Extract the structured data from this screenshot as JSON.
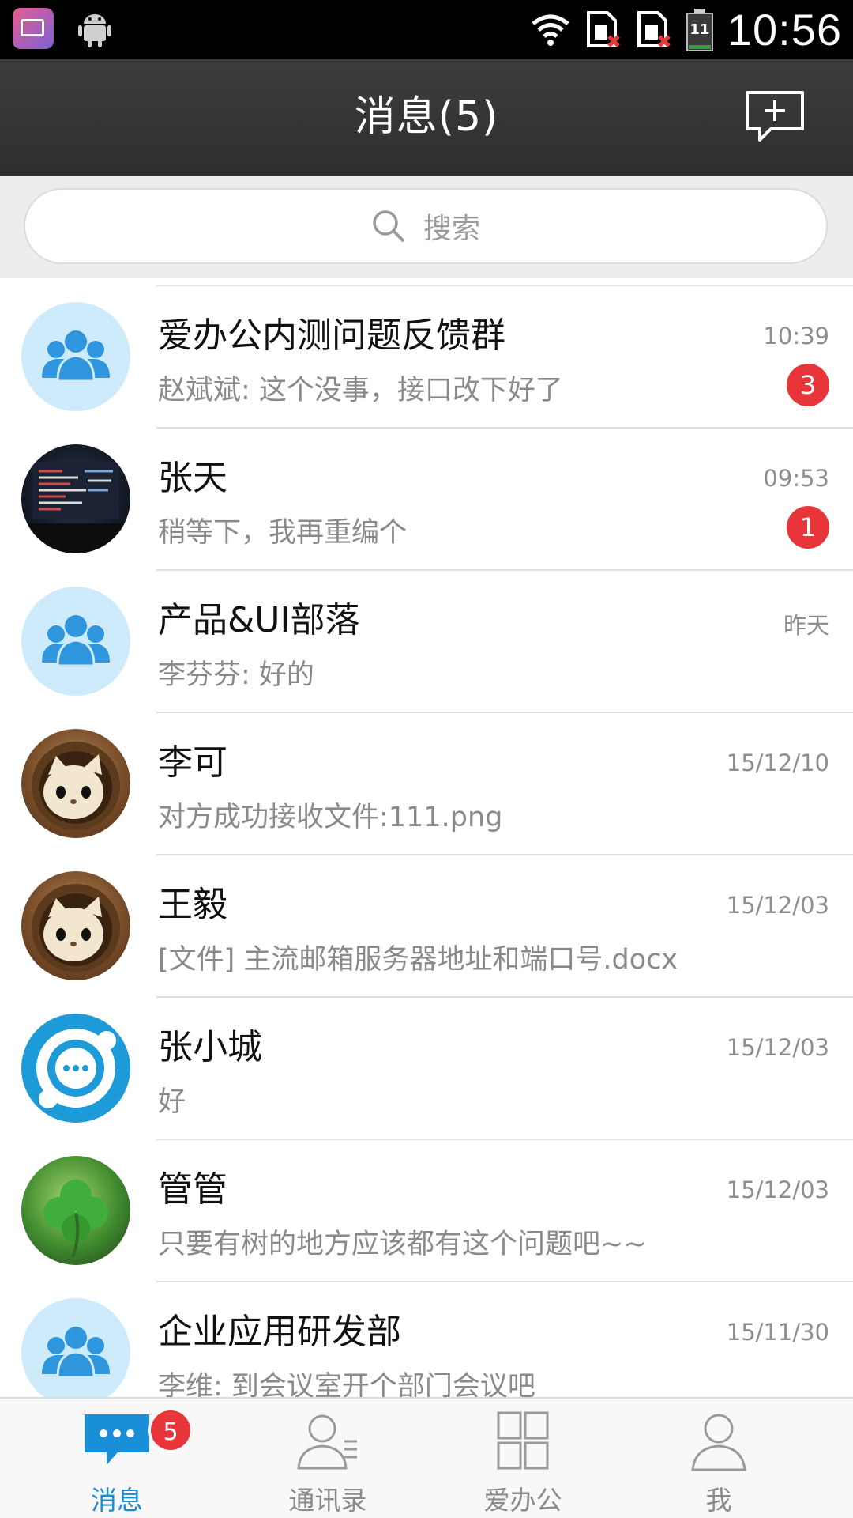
{
  "status_bar": {
    "time": "10:56",
    "battery_level": "11",
    "icons": [
      "mail-app-icon",
      "android-icon",
      "wifi-icon",
      "sim-card-icon",
      "sim-card-icon",
      "battery-icon"
    ]
  },
  "header": {
    "title": "消息(5)",
    "compose_icon": "new-chat-icon"
  },
  "search": {
    "placeholder": "搜索",
    "icon": "search-icon"
  },
  "conversations": [
    {
      "name": "爱办公内测问题反馈群",
      "time": "10:39",
      "preview": "赵斌斌: 这个没事，接口改下好了",
      "unread": "3",
      "avatar": "group-avatar"
    },
    {
      "name": "张天",
      "time": "09:53",
      "preview": "稍等下，我再重编个",
      "unread": "1",
      "avatar": "code-screen-avatar"
    },
    {
      "name": "产品&UI部落",
      "time": "昨天",
      "preview": "李芬芬: 好的",
      "unread": "",
      "avatar": "group-avatar"
    },
    {
      "name": "李可",
      "time": "15/12/10",
      "preview": "对方成功接收文件:111.png",
      "unread": "",
      "avatar": "cat-avatar"
    },
    {
      "name": "王毅",
      "time": "15/12/03",
      "preview": "[文件] 主流邮箱服务器地址和端口号.docx",
      "unread": "",
      "avatar": "cat-avatar"
    },
    {
      "name": "张小城",
      "time": "15/12/03",
      "preview": "好",
      "unread": "",
      "avatar": "chat-logo-avatar"
    },
    {
      "name": "管管",
      "time": "15/12/03",
      "preview": "只要有树的地方应该都有这个问题吧~~",
      "unread": "",
      "avatar": "clover-avatar"
    },
    {
      "name": "企业应用研发部",
      "time": "15/11/30",
      "preview": "李维: 到会议室开个部门会议吧",
      "unread": "",
      "avatar": "group-avatar"
    }
  ],
  "tabs": [
    {
      "label": "消息",
      "icon": "message-bubble-icon",
      "active": true,
      "badge": "5"
    },
    {
      "label": "通讯录",
      "icon": "contacts-icon",
      "active": false,
      "badge": ""
    },
    {
      "label": "爱办公",
      "icon": "apps-grid-icon",
      "active": false,
      "badge": ""
    },
    {
      "label": "我",
      "icon": "profile-icon",
      "active": false,
      "badge": ""
    }
  ],
  "colors": {
    "accent": "#1a8fd8",
    "badge": "#e8353a",
    "header_bg": "#333333",
    "group_avatar_bg": "#cdebfb"
  }
}
